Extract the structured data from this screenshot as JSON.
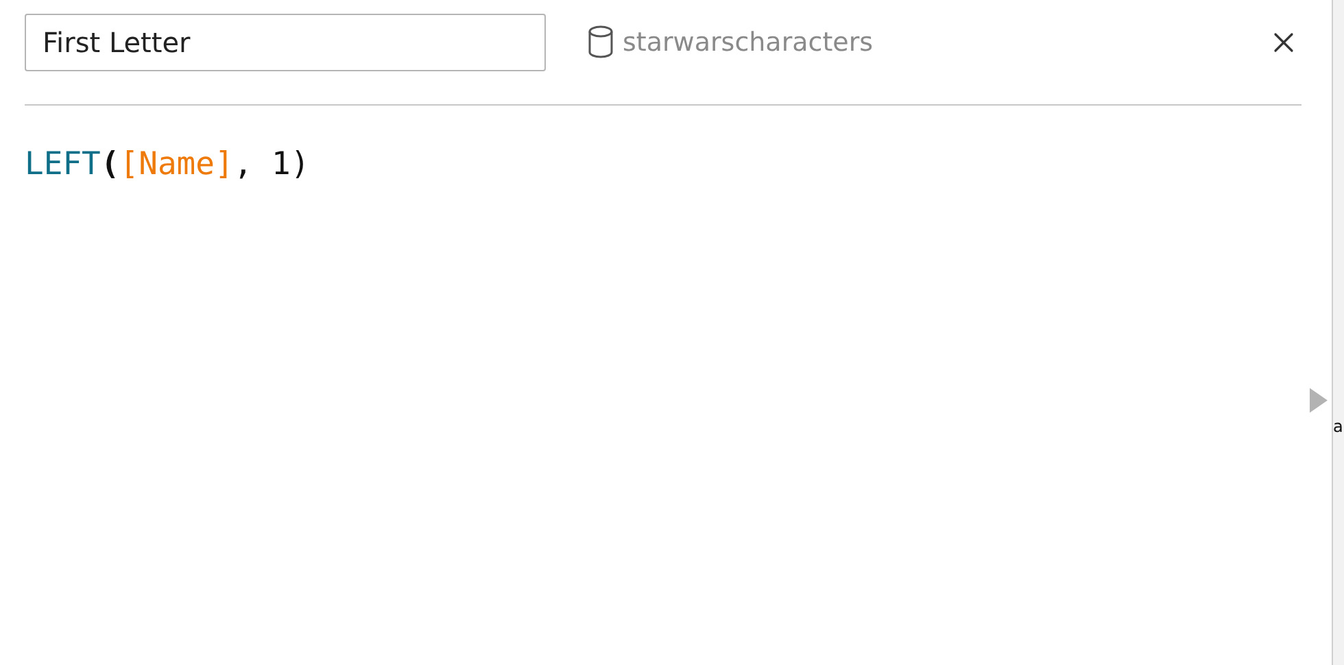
{
  "calc_editor": {
    "name_field": {
      "value": "First Letter"
    },
    "data_source": "starwarscharacters",
    "formula": [
      {
        "kind": "function",
        "text": "LEFT"
      },
      {
        "kind": "punct",
        "text": "("
      },
      {
        "kind": "field",
        "text": "[Name]"
      },
      {
        "kind": "plain",
        "text": ", 1)"
      }
    ]
  },
  "side_strip": {
    "text": "a"
  }
}
